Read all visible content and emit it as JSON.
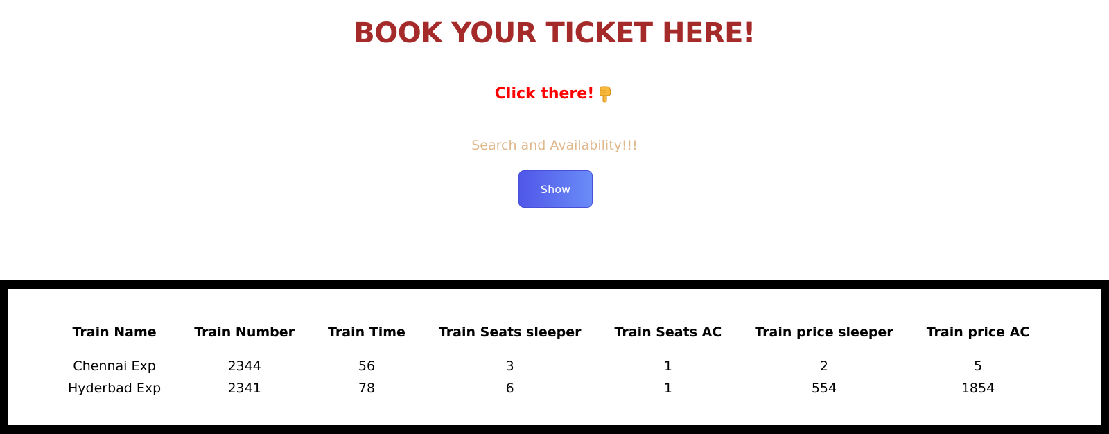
{
  "header": {
    "title": "BOOK YOUR TICKET HERE!"
  },
  "cta": {
    "click_label": "Click there!",
    "pointer_icon": "hand-pointing-down-icon"
  },
  "search": {
    "subtitle": "Search and Availability!!!",
    "show_label": "Show"
  },
  "colors": {
    "title": "#a52a2a",
    "click": "#ff0000",
    "subtitle": "#dfb88c",
    "button_start": "#5057e8",
    "button_end": "#6a8cf8",
    "frame": "#000000"
  },
  "table": {
    "columns": [
      "Train Name",
      "Train Number",
      "Train Time",
      "Train Seats sleeper",
      "Train Seats AC",
      "Train price sleeper",
      "Train price AC"
    ],
    "rows": [
      [
        "Chennai Exp",
        "2344",
        "56",
        "3",
        "1",
        "2",
        "5"
      ],
      [
        "Hyderbad Exp",
        "2341",
        "78",
        "6",
        "1",
        "554",
        "1854"
      ]
    ]
  }
}
